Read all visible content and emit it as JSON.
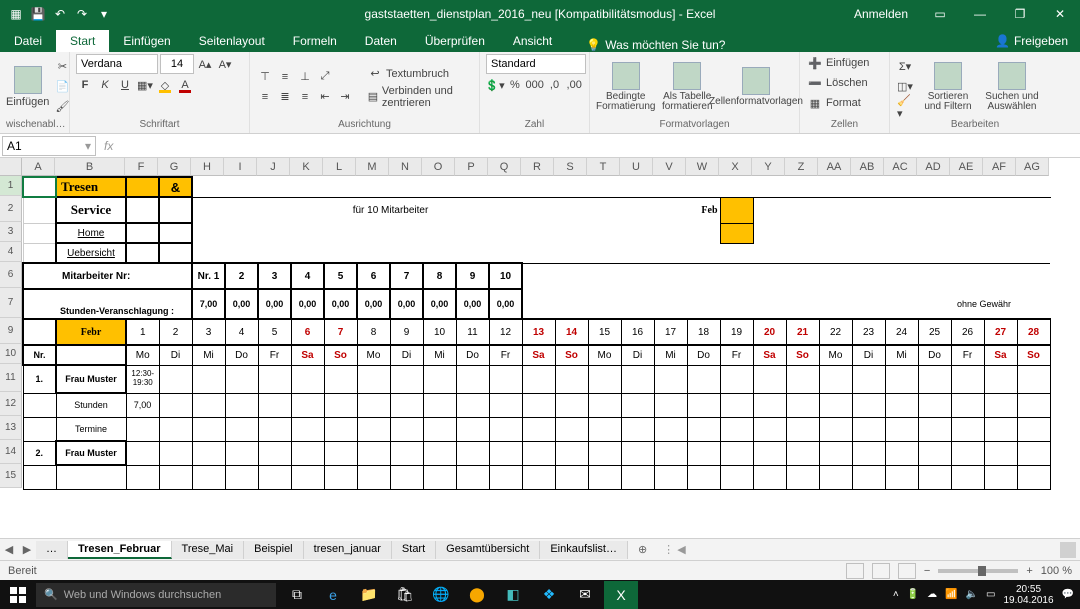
{
  "app": {
    "title_left": "gaststaetten_dienstplan_2016_neu  [Kompatibilitätsmodus] - Excel",
    "login": "Anmelden"
  },
  "ribbon_tabs": {
    "file": "Datei",
    "home": "Start",
    "insert": "Einfügen",
    "layout": "Seitenlayout",
    "formulas": "Formeln",
    "data": "Daten",
    "review": "Überprüfen",
    "view": "Ansicht",
    "tell": "Was möchten Sie tun?",
    "share": "Freigeben"
  },
  "ribbon": {
    "clipboard": {
      "paste": "Einfügen",
      "group": "wischenabl…"
    },
    "font": {
      "name": "Verdana",
      "size": "14",
      "bold": "F",
      "italic": "K",
      "underline": "U",
      "group": "Schriftart"
    },
    "align": {
      "wrap": "Textumbruch",
      "merge": "Verbinden und zentrieren",
      "group": "Ausrichtung"
    },
    "number": {
      "format": "Standard",
      "group": "Zahl"
    },
    "styles": {
      "cond": "Bedingte Formatierung",
      "table": "Als Tabelle formatieren",
      "cell": "Zellenformatvorlagen",
      "group": "Formatvorlagen"
    },
    "cells": {
      "insert": "Einfügen",
      "delete": "Löschen",
      "format": "Format",
      "group": "Zellen"
    },
    "editing": {
      "sort": "Sortieren und Filtern",
      "find": "Suchen und Auswählen",
      "group": "Bearbeiten"
    }
  },
  "namebox": "A1",
  "columns": [
    "A",
    "B",
    "F",
    "G",
    "H",
    "I",
    "J",
    "K",
    "L",
    "M",
    "N",
    "O",
    "P",
    "Q",
    "R",
    "S",
    "T",
    "U",
    "V",
    "W",
    "X",
    "Y",
    "Z",
    "AA",
    "AB",
    "AC",
    "AD",
    "AE",
    "AF",
    "AG"
  ],
  "rows_visible": [
    "1",
    "2",
    "3",
    "4",
    "6",
    "7",
    "9",
    "10",
    "11",
    "12",
    "13",
    "14",
    "15"
  ],
  "sheet": {
    "r1": {
      "tresen": "Tresen",
      "amp": "&"
    },
    "r2": {
      "service": "Service",
      "subtitle": "für 10 Mitarbeiter",
      "month": "Feb"
    },
    "r3": "Home",
    "r4": "Uebersicht",
    "mitarbeiter_label": "Mitarbeiter Nr:",
    "mitarbeiter_nr": [
      "Nr. 1",
      "2",
      "3",
      "4",
      "5",
      "6",
      "7",
      "8",
      "9",
      "10"
    ],
    "stunden_label": "Stunden-Veranschlagung :",
    "stunden_vals": [
      "7,00",
      "0,00",
      "0,00",
      "0,00",
      "0,00",
      "0,00",
      "0,00",
      "0,00",
      "0,00",
      "0,00"
    ],
    "ohne_gewaehr": "ohne Gewähr",
    "febr": "Febr",
    "days": [
      1,
      2,
      3,
      4,
      5,
      6,
      7,
      8,
      9,
      10,
      11,
      12,
      13,
      14,
      15,
      16,
      17,
      18,
      19,
      20,
      21,
      22,
      23,
      24,
      25,
      26,
      27,
      28
    ],
    "weekend_days": [
      6,
      7,
      13,
      14,
      20,
      21,
      27,
      28
    ],
    "nr_label": "Nr.",
    "dow": [
      "Mo",
      "Di",
      "Mi",
      "Do",
      "Fr",
      "Sa",
      "So",
      "Mo",
      "Di",
      "Mi",
      "Do",
      "Fr",
      "Sa",
      "So",
      "Mo",
      "Di",
      "Mi",
      "Do",
      "Fr",
      "Sa",
      "So",
      "Mo",
      "Di",
      "Mi",
      "Do",
      "Fr",
      "Sa",
      "So"
    ],
    "weekend_dow_idx": [
      5,
      6,
      12,
      13,
      19,
      20,
      26,
      27
    ],
    "row11_nr": "1.",
    "row11_name": "Frau Muster",
    "row11_shift": "12:30-19:30",
    "row12_name": "Stunden",
    "row12_val": "7,00",
    "row13_name": "Termine",
    "row14_nr": "2.",
    "row14_name": "Frau Muster"
  },
  "tabs": [
    "…",
    "Tresen_Februar",
    "Trese_Mai",
    "Beispiel",
    "tresen_januar",
    "Start",
    "Gesamtübersicht",
    "Einkaufslist…"
  ],
  "active_tab_index": 1,
  "status": {
    "ready": "Bereit",
    "zoom": "100 %"
  },
  "taskbar": {
    "search_placeholder": "Web und Windows durchsuchen",
    "clock_time": "20:55",
    "clock_date": "19.04.2016"
  }
}
